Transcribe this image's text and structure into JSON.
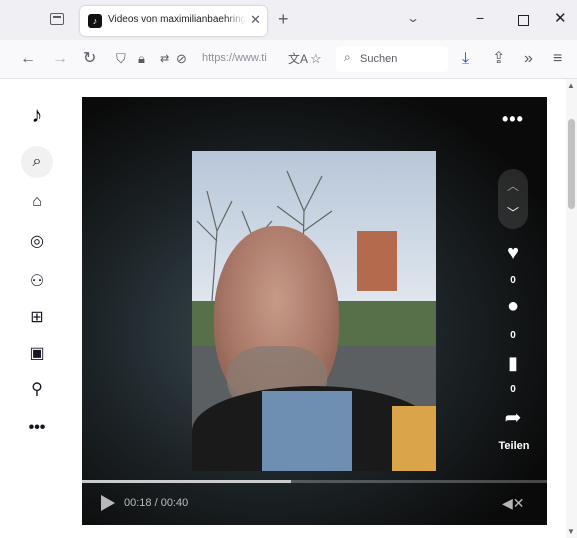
{
  "browser": {
    "tab": {
      "favicon": "tiktok-icon",
      "title": "Videos von maximilianbaehring"
    },
    "icons": {
      "tab_list": "tab-list-icon",
      "new_tab": "+",
      "tabs_dropdown": "chevron-down-icon",
      "minimize": "−",
      "close": "✕"
    },
    "nav": {
      "back": "←",
      "forward": "→",
      "reload": "↻",
      "url": "https://www.ti",
      "search_placeholder": "Suchen"
    }
  },
  "sidebar": {
    "items": [
      "tiktok-logo-icon",
      "search-icon",
      "home-icon",
      "explore-icon",
      "following-icon",
      "upload-icon",
      "live-icon",
      "profile-icon",
      "more-icon"
    ]
  },
  "player": {
    "actions": {
      "like_count": "0",
      "comment_count": "0",
      "save_count": "0",
      "share_label": "Teilen"
    },
    "time": "00:18 / 00:40",
    "progress": 0.45
  },
  "colors": {
    "accent": "#fe2c55",
    "text": "#161823"
  }
}
